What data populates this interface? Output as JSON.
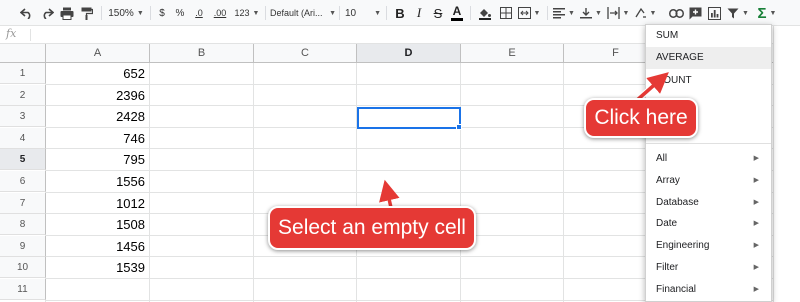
{
  "toolbar": {
    "zoom": "150%",
    "currency": "$",
    "percent": "%",
    "decimal_decrease": ".0",
    "decimal_increase": ".00",
    "more_formats": "123",
    "font": "Default (Ari...",
    "font_size": "10",
    "bold": "B",
    "italic": "I",
    "strikethrough": "S",
    "text_color": "A",
    "functions": "Σ"
  },
  "formula_bar": {
    "fx": "fx",
    "value": ""
  },
  "grid": {
    "columns": [
      "A",
      "B",
      "C",
      "D",
      "E",
      "F"
    ],
    "selected_column": "D",
    "rows": [
      "1",
      "2",
      "3",
      "4",
      "5",
      "6",
      "7",
      "8",
      "9",
      "10",
      "11"
    ],
    "selected_row": "5",
    "column_a_values": [
      "652",
      "2396",
      "2428",
      "746",
      "795",
      "1556",
      "1012",
      "1508",
      "1456",
      "1539"
    ]
  },
  "menu": {
    "top_items": [
      "SUM",
      "AVERAGE",
      "COUNT"
    ],
    "highlighted": "AVERAGE",
    "categories": [
      "All",
      "Array",
      "Database",
      "Date",
      "Engineering",
      "Filter",
      "Financial"
    ]
  },
  "callouts": {
    "click_here": "Click here",
    "select_cell": "Select an empty cell"
  },
  "colors": {
    "callout": "#e53935",
    "selection": "#1a73e8",
    "functions_icon": "#188038"
  }
}
